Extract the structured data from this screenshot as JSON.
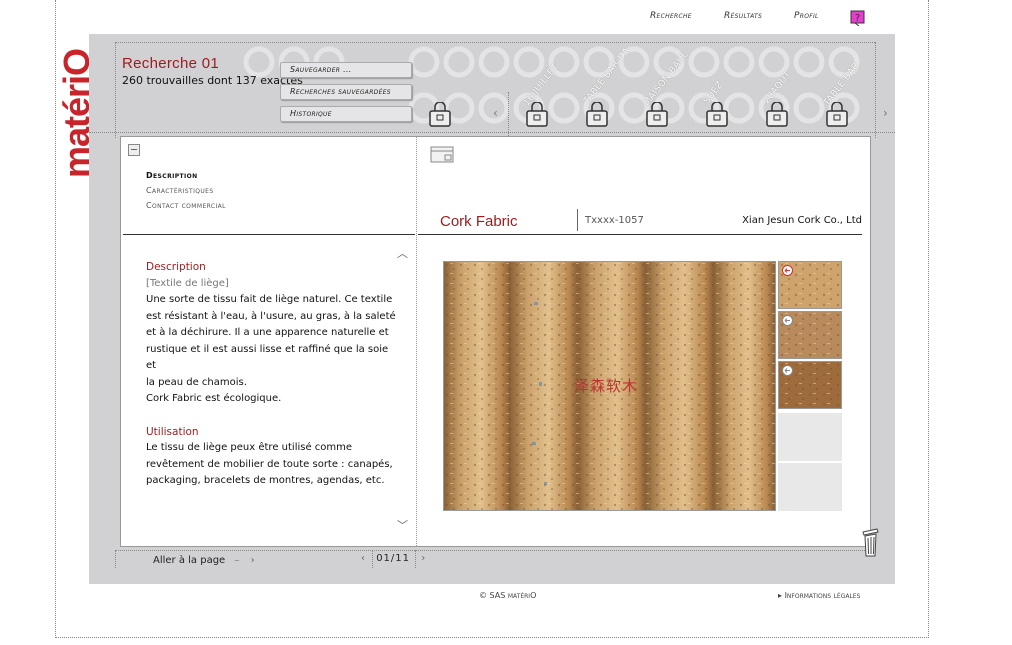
{
  "brand": {
    "name": "matériO",
    "accent": "#9b1b1e"
  },
  "topnav": {
    "search": "Recherche",
    "results": "Résultats",
    "profile": "Profil",
    "help": "?"
  },
  "search": {
    "title": "Recherche 01",
    "count": "260 trouvailles dont 137 exactes"
  },
  "tabs": {
    "save": "Sauvegarder ...",
    "saved": "Recherches sauvegardées",
    "history": "Historique"
  },
  "basket": {
    "labels": [
      "16/JUILLET",
      "TABLE BAR DA",
      "MAISON BAUL",
      "SUEZ",
      "20AOUT",
      "TABLE BAR"
    ]
  },
  "sidenav": {
    "items": [
      "Description",
      "Caractéristiques",
      "Contact commercial"
    ]
  },
  "product": {
    "name": "Cork Fabric",
    "ref": "Txxxx-1057",
    "company": "Xian Jesun Cork Co., Ltd",
    "watermark": "泽森软木",
    "description_title": "Description",
    "description_subtitle": "[Textile de liège]",
    "description_lines": [
      "Une sorte de tissu fait de liège naturel. Ce textile",
      "est résistant à l'eau, à l'usure, au gras, à la saleté",
      "et à la déchirure. Il a une apparence naturelle et",
      "rustique et il est aussi lisse et raffiné que la soie et",
      "la peau de chamois.",
      "Cork Fabric est écologique."
    ],
    "usage_title": "Utilisation",
    "usage_lines": [
      "Le tissu de liège peux être utilisé comme",
      "revêtement de mobilier de toute sorte : canapés,",
      "packaging, bracelets de montres, agendas, etc."
    ]
  },
  "footer": {
    "goto": "Aller à la page",
    "page": "01/11",
    "copyright": "© SAS matériO",
    "legal": "Informations légales"
  }
}
